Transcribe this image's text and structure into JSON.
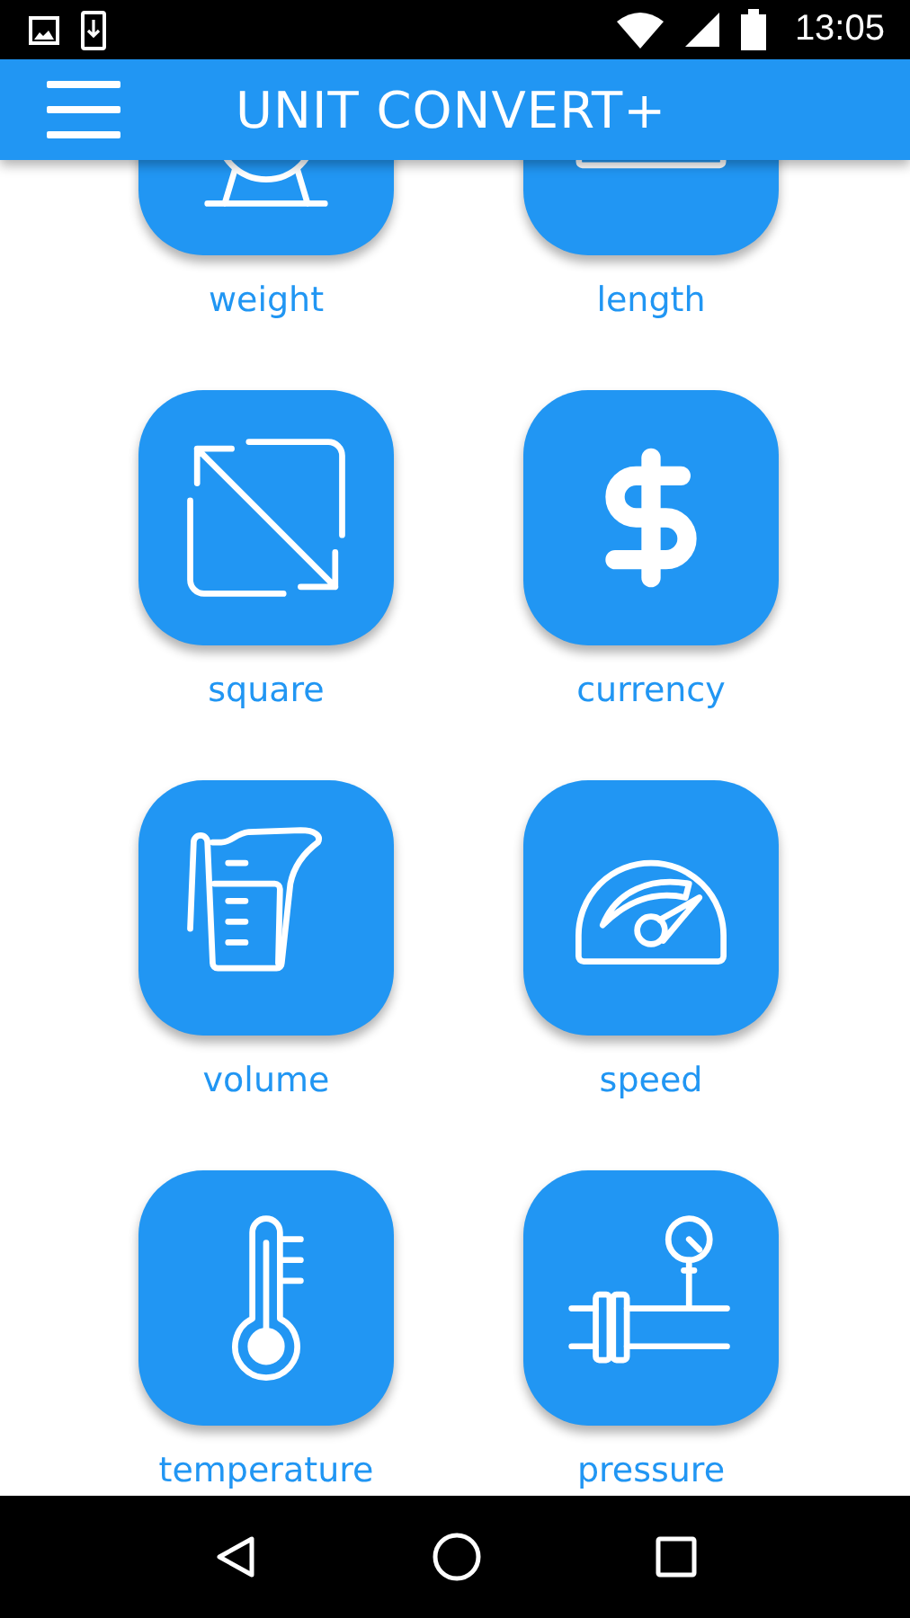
{
  "status_bar": {
    "time": "13:05"
  },
  "app_bar": {
    "title": "UNIT CONVERT+"
  },
  "units": [
    {
      "label": "weight"
    },
    {
      "label": "length"
    },
    {
      "label": "square"
    },
    {
      "label": "currency"
    },
    {
      "label": "volume"
    },
    {
      "label": "speed"
    },
    {
      "label": "temperature"
    },
    {
      "label": "pressure"
    }
  ]
}
